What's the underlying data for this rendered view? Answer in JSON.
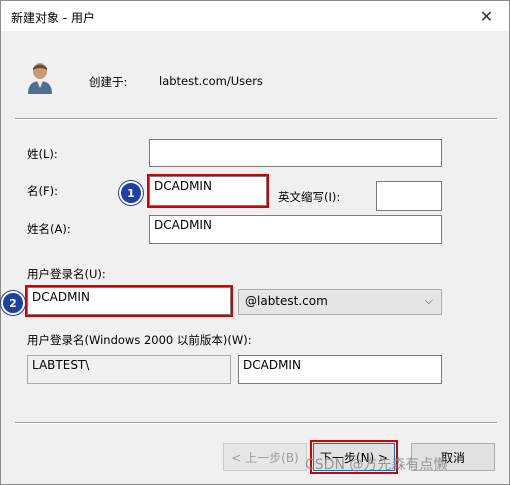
{
  "window": {
    "title": "新建对象 - 用户"
  },
  "header": {
    "created_in_label": "创建于:",
    "created_in_value": "labtest.com/Users",
    "icon": "user-icon"
  },
  "form": {
    "last_name_label": "姓(L):",
    "last_name_value": "",
    "first_name_label": "名(F):",
    "first_name_value": "DCADMIN",
    "initials_label": "英文缩写(I):",
    "initials_value": "",
    "full_name_label": "姓名(A):",
    "full_name_value": "DCADMIN",
    "logon_label": "用户登录名(U):",
    "logon_value": "DCADMIN",
    "domain_value": "@labtest.com",
    "pre2000_label": "用户登录名(Windows 2000 以前版本)(W):",
    "pre2000_domain": "LABTEST\\",
    "pre2000_value": "DCADMIN"
  },
  "annotations": {
    "badge1": "1",
    "badge2": "2",
    "highlight_color": "#d40000",
    "badge_color": "#1c3fa8"
  },
  "buttons": {
    "back": "< 上一步(B)",
    "next": "下一步(N) >",
    "cancel": "取消"
  },
  "watermark": "CSDN @方先森有点懒"
}
